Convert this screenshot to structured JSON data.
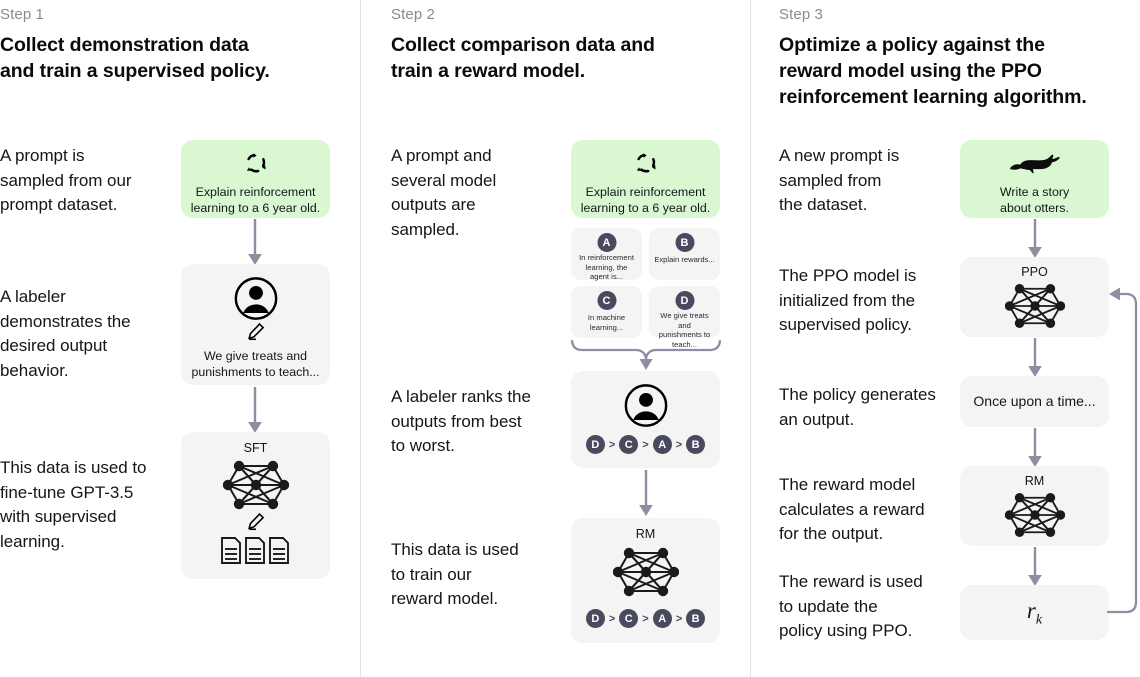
{
  "colors": {
    "green_card": "#d9f8d2",
    "gray_card": "#f4f4f4",
    "badge": "#4a4a5e",
    "arrow": "#8e8ea0",
    "divider": "#e2e2e4",
    "step_label": "#8a8a90"
  },
  "steps": [
    {
      "label": "Step 1",
      "title_line1": "Collect demonstration data",
      "title_line2": "and train a supervised policy.",
      "paragraphs": [
        "A prompt is\nsampled from our\nprompt dataset.",
        "A labeler\ndemonstrates the\ndesired output\nbehavior.",
        "This data is used to\nfine-tune GPT-3.5\nwith supervised\nlearning."
      ],
      "cards": [
        {
          "icon": "refresh-cycle-icon",
          "caption": "Explain reinforcement\nlearning to a 6 year old."
        },
        {
          "icon": "labeler-person-icon",
          "caption": "We give treats and\npunishments to teach..."
        },
        {
          "title": "SFT",
          "icon": "neural-network-icon"
        }
      ]
    },
    {
      "label": "Step 2",
      "title_line1": "Collect comparison data and",
      "title_line2": "train a reward model.",
      "paragraphs": [
        "A prompt and\nseveral model\noutputs are\nsampled.",
        "A labeler ranks the\noutputs from best\nto worst.",
        "This data is used\nto train our\nreward model."
      ],
      "prompt_card": {
        "icon": "refresh-cycle-icon",
        "caption": "Explain reinforcement\nlearning to a 6 year old."
      },
      "options": [
        {
          "letter": "A",
          "text": "In reinforcement\nlearning, the\nagent is..."
        },
        {
          "letter": "B",
          "text": "Explain rewards..."
        },
        {
          "letter": "C",
          "text": "In machine\nlearning..."
        },
        {
          "letter": "D",
          "text": "We give treats and\npunishments to\nteach..."
        }
      ],
      "ranking": [
        "D",
        "C",
        "A",
        "B"
      ],
      "ranking_separator": ">",
      "labeler_card": {
        "icon": "labeler-person-icon"
      },
      "rm_card": {
        "title": "RM",
        "icon": "neural-network-icon"
      }
    },
    {
      "label": "Step 3",
      "title_line1": "Optimize a policy against the",
      "title_line2": "reward model using the PPO",
      "title_line3": "reinforcement learning algorithm.",
      "paragraphs": [
        "A new prompt is\nsampled from\nthe dataset.",
        "The PPO model is\ninitialized from the\nsupervised policy.",
        "The policy generates\nan output.",
        "The reward model\ncalculates a reward\nfor the output.",
        "The reward is used\nto update the\npolicy using PPO."
      ],
      "cards": [
        {
          "icon": "otter-icon",
          "caption": "Write a story\nabout otters."
        },
        {
          "title": "PPO",
          "icon": "neural-network-icon"
        },
        {
          "text": "Once upon a time..."
        },
        {
          "title": "RM",
          "icon": "neural-network-icon"
        },
        {
          "reward_symbol": "r",
          "reward_subscript": "k"
        }
      ]
    }
  ]
}
